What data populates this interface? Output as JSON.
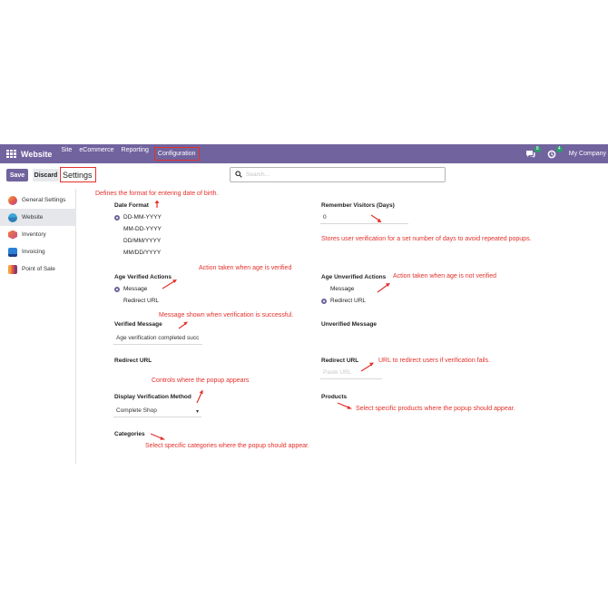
{
  "navbar": {
    "brand": "Website",
    "menu": [
      "Site",
      "eCommerce",
      "Reporting",
      "Configuration"
    ],
    "chat_badge": "8",
    "activity_badge": "4",
    "company": "My Company"
  },
  "control": {
    "save": "Save",
    "discard": "Discard",
    "title": "Settings",
    "search_placeholder": "Search..."
  },
  "sidebar": {
    "items": [
      "General Settings",
      "Website",
      "Inventory",
      "Invoicing",
      "Point of Sale"
    ]
  },
  "form": {
    "date_format": {
      "label": "Date Format",
      "options": [
        "DD-MM-YYYY",
        "MM-DD-YYYY",
        "DD/MM/YYYY",
        "MM/DD/YYYY"
      ],
      "selected": "DD-MM-YYYY"
    },
    "remember": {
      "label": "Remember Visitors (Days)",
      "value": "0"
    },
    "verified_actions": {
      "label": "Age Verified Actions",
      "options": [
        "Message",
        "Redirect URL"
      ],
      "selected": "Message"
    },
    "unverified_actions": {
      "label": "Age Unverified Actions",
      "options": [
        "Message",
        "Redirect URL"
      ],
      "selected": "Redirect URL"
    },
    "verified_message": {
      "label": "Verified Message",
      "value": "Age verification completed succ"
    },
    "unverified_message": {
      "label": "Unverified Message"
    },
    "redirect_url_left": {
      "label": "Redirect URL"
    },
    "redirect_url_right": {
      "label": "Redirect URL",
      "placeholder": "Paste URL"
    },
    "display_method": {
      "label": "Display Verification Method",
      "value": "Complete Shop"
    },
    "products": {
      "label": "Products"
    },
    "categories": {
      "label": "Categories"
    }
  },
  "notes": {
    "date_format": "Defines the format for entering date of birth.",
    "remember": "Stores user verification for a set number of days to avoid repeated popups.",
    "verified": "Action taken when age is verified",
    "unverified": "Action taken when age is not verified",
    "message": "Message shown when verification is successful.",
    "redirect": "URL to redirect users if verification fails.",
    "popup": "Controls where the popup appears",
    "products": "Select specific products where the popup should appear.",
    "categories": "Select specific categories where the popup should appear."
  },
  "colors": {
    "navbar": "#71639e",
    "annotation": "#e3312c",
    "accent": "#71639e"
  }
}
